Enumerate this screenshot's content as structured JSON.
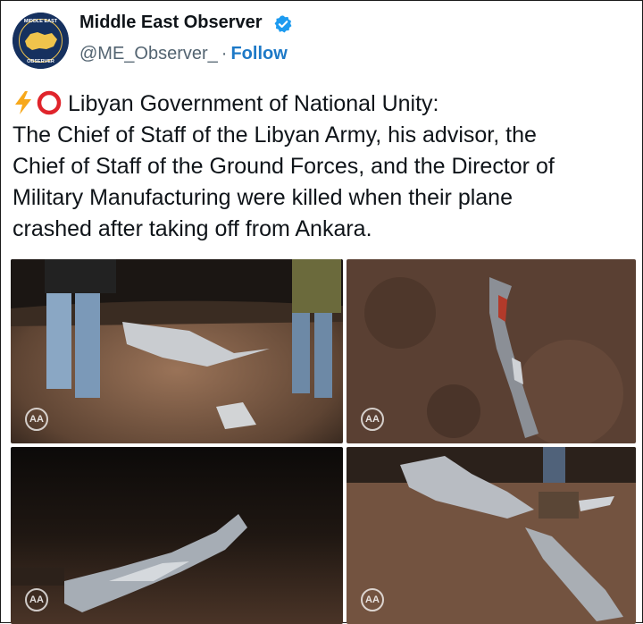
{
  "account": {
    "name": "Middle East Observer",
    "handle": "@ME_Observer_",
    "separator": "·",
    "follow_label": "Follow",
    "verified_color": "#1d9bf0",
    "avatar_ring_text_top": "MIDDLE EAST",
    "avatar_ring_text_bottom": "OBSERVER"
  },
  "tweet": {
    "lines": [
      "Libyan Government of National Unity:",
      "The Chief of Staff of the Libyan Army, his advisor, the",
      "Chief of Staff of the Ground Forces, and the Director of",
      "Military Manufacturing were killed when their plane",
      "crashed after taking off from Ankara."
    ],
    "leading_icons": [
      "lightning-emoji",
      "red-circle-emoji"
    ]
  },
  "photos": [
    {
      "watermark": "AA",
      "scene": "debris with two people standing"
    },
    {
      "watermark": "AA",
      "scene": "twisted debris strip on ground"
    },
    {
      "watermark": "AA",
      "scene": "crumpled metal in darkness"
    },
    {
      "watermark": "AA",
      "scene": "scattered wreckage on soil"
    }
  ]
}
